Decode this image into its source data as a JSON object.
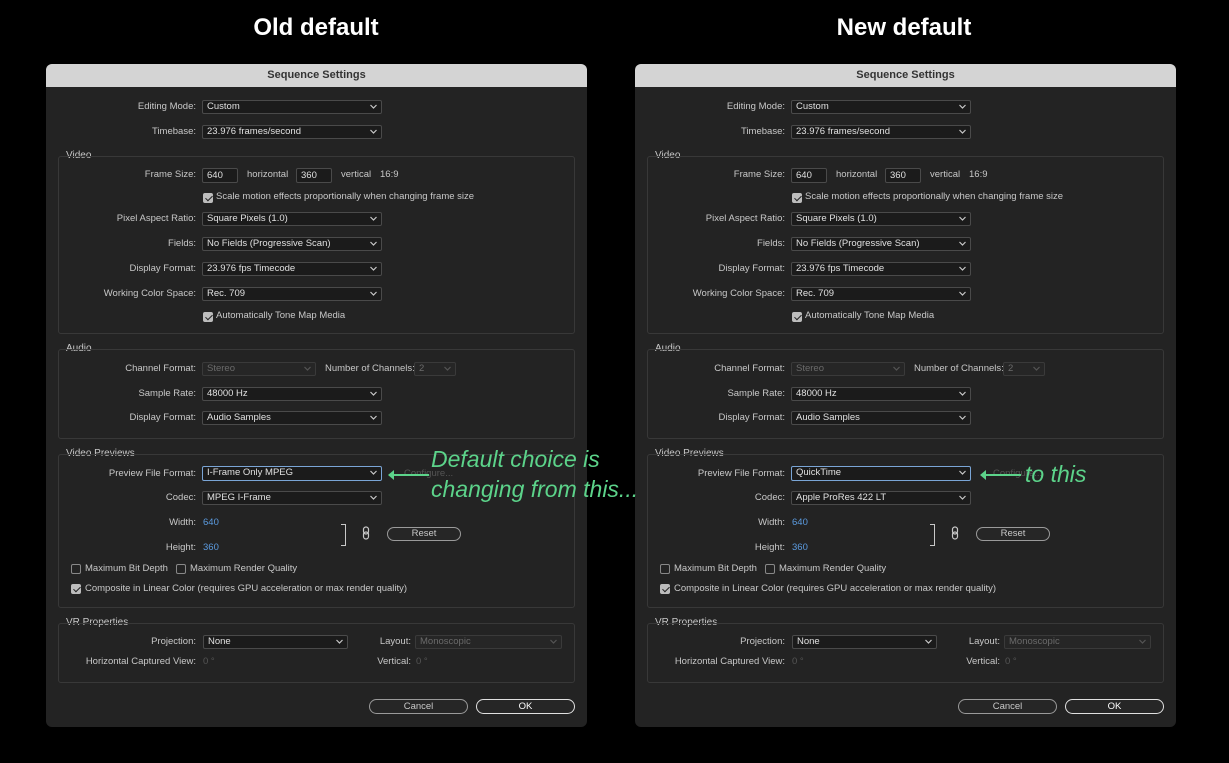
{
  "headings": {
    "left": "Old default",
    "right": "New default"
  },
  "annotations": {
    "left_line1": "Default choice is",
    "left_line2": "changing from this...",
    "right": "to this"
  },
  "left": {
    "title": "Sequence Settings",
    "editing_mode": {
      "label": "Editing Mode:",
      "value": "Custom"
    },
    "timebase": {
      "label": "Timebase:",
      "value": "23.976  frames/second"
    },
    "video": {
      "title": "Video",
      "frame_size_label": "Frame Size:",
      "frame_w": "640",
      "horizontal": "horizontal",
      "frame_h": "360",
      "vertical": "vertical",
      "aspect": "16:9",
      "scale_motion": "Scale motion effects proportionally when changing frame size",
      "par_label": "Pixel Aspect Ratio:",
      "par_value": "Square Pixels (1.0)",
      "fields_label": "Fields:",
      "fields_value": "No Fields (Progressive Scan)",
      "display_label": "Display Format:",
      "display_value": "23.976 fps Timecode",
      "wcs_label": "Working Color Space:",
      "wcs_value": "Rec. 709",
      "tone_map": "Automatically Tone Map Media"
    },
    "audio": {
      "title": "Audio",
      "channel_label": "Channel Format:",
      "channel_value": "Stereo",
      "num_channels_label": "Number of Channels:",
      "num_channels_value": "2",
      "sample_label": "Sample Rate:",
      "sample_value": "48000 Hz",
      "display_label": "Display Format:",
      "display_value": "Audio Samples"
    },
    "previews": {
      "title": "Video Previews",
      "pff_label": "Preview File Format:",
      "pff_value": "I-Frame Only MPEG",
      "configure": "Configure...",
      "codec_label": "Codec:",
      "codec_value": "MPEG I-Frame",
      "width_label": "Width:",
      "width_value": "640",
      "height_label": "Height:",
      "height_value": "360",
      "reset": "Reset",
      "max_bit": "Maximum Bit Depth",
      "max_render": "Maximum Render Quality",
      "composite": "Composite in Linear Color (requires GPU acceleration or max render quality)"
    },
    "vr": {
      "title": "VR Properties",
      "projection_label": "Projection:",
      "projection_value": "None",
      "layout_label": "Layout:",
      "layout_value": "Monoscopic",
      "hcv_label": "Horizontal Captured View:",
      "hcv_value": "0 °",
      "vertical_label": "Vertical:",
      "vertical_value": "0 °"
    },
    "cancel": "Cancel",
    "ok": "OK"
  },
  "right": {
    "title": "Sequence Settings",
    "editing_mode": {
      "label": "Editing Mode:",
      "value": "Custom"
    },
    "timebase": {
      "label": "Timebase:",
      "value": "23.976  frames/second"
    },
    "video": {
      "title": "Video",
      "frame_size_label": "Frame Size:",
      "frame_w": "640",
      "horizontal": "horizontal",
      "frame_h": "360",
      "vertical": "vertical",
      "aspect": "16:9",
      "scale_motion": "Scale motion effects proportionally when changing frame size",
      "par_label": "Pixel Aspect Ratio:",
      "par_value": "Square Pixels (1.0)",
      "fields_label": "Fields:",
      "fields_value": "No Fields (Progressive Scan)",
      "display_label": "Display Format:",
      "display_value": "23.976 fps Timecode",
      "wcs_label": "Working Color Space:",
      "wcs_value": "Rec. 709",
      "tone_map": "Automatically Tone Map Media"
    },
    "audio": {
      "title": "Audio",
      "channel_label": "Channel Format:",
      "channel_value": "Stereo",
      "num_channels_label": "Number of Channels:",
      "num_channels_value": "2",
      "sample_label": "Sample Rate:",
      "sample_value": "48000 Hz",
      "display_label": "Display Format:",
      "display_value": "Audio Samples"
    },
    "previews": {
      "title": "Video Previews",
      "pff_label": "Preview File Format:",
      "pff_value": "QuickTime",
      "configure": "Configure...",
      "codec_label": "Codec:",
      "codec_value": "Apple ProRes 422 LT",
      "width_label": "Width:",
      "width_value": "640",
      "height_label": "Height:",
      "height_value": "360",
      "reset": "Reset",
      "max_bit": "Maximum Bit Depth",
      "max_render": "Maximum Render Quality",
      "composite": "Composite in Linear Color (requires GPU acceleration or max render quality)"
    },
    "vr": {
      "title": "VR Properties",
      "projection_label": "Projection:",
      "projection_value": "None",
      "layout_label": "Layout:",
      "layout_value": "Monoscopic",
      "hcv_label": "Horizontal Captured View:",
      "hcv_value": "0 °",
      "vertical_label": "Vertical:",
      "vertical_value": "0 °"
    },
    "cancel": "Cancel",
    "ok": "OK"
  },
  "colors": {
    "annotation": "#5cd38a",
    "link_value": "#5b9be0",
    "background": "#000000",
    "dialog": "#232323"
  },
  "icons": {
    "dropdown": "chevron-down-icon",
    "checkbox": "checkmark-icon",
    "link": "chain-link-icon",
    "arrow": "arrow-left-icon"
  }
}
